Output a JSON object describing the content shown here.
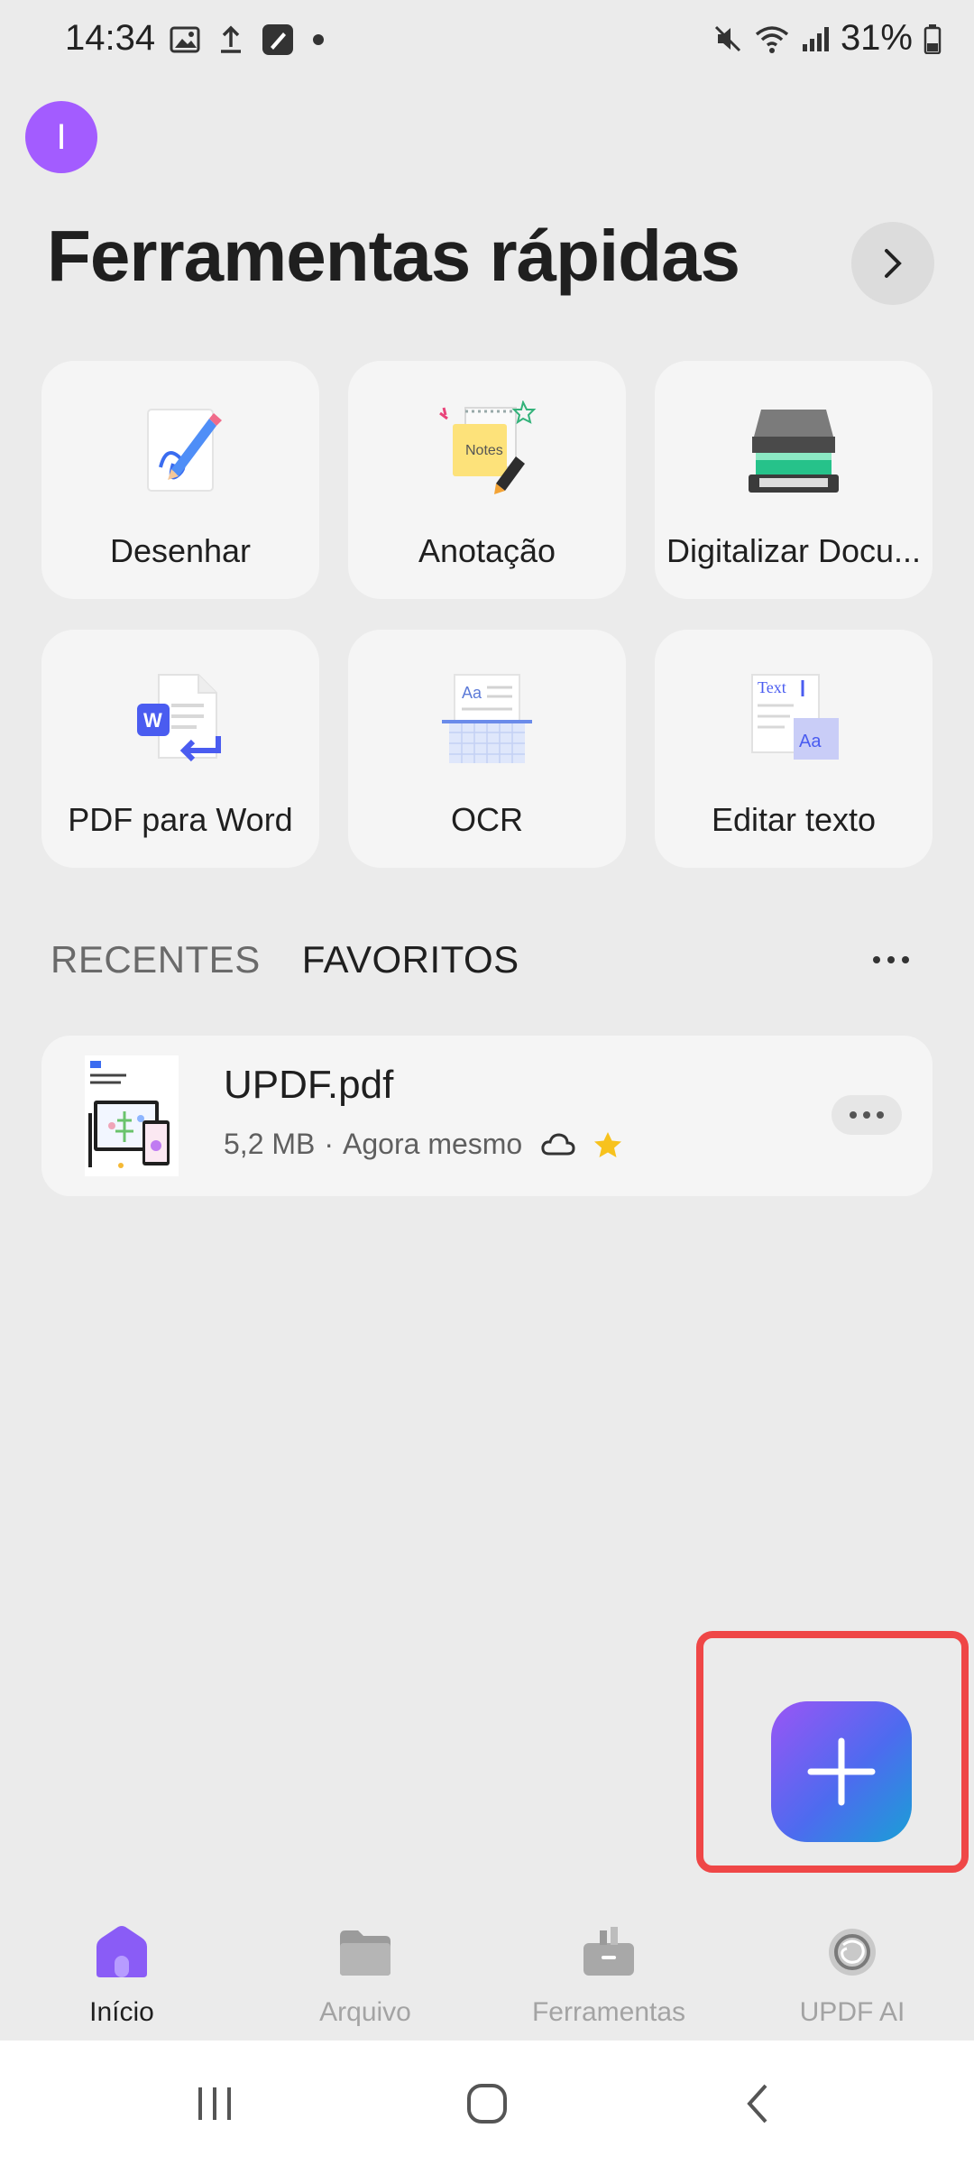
{
  "status_bar": {
    "time": "14:34",
    "battery": "31%"
  },
  "avatar": {
    "initial": "I"
  },
  "quick_tools": {
    "title": "Ferramentas rápidas",
    "items": [
      {
        "label": "Desenhar",
        "icon": "draw-icon"
      },
      {
        "label": "Anotação",
        "icon": "notes-icon"
      },
      {
        "label": "Digitalizar Docu...",
        "icon": "scanner-icon"
      },
      {
        "label": "PDF para Word",
        "icon": "pdf-to-word-icon"
      },
      {
        "label": "OCR",
        "icon": "ocr-icon"
      },
      {
        "label": "Editar texto",
        "icon": "edit-text-icon"
      }
    ]
  },
  "tabs": {
    "recent": "RECENTES",
    "favorites": "FAVORITOS",
    "active": "FAVORITOS"
  },
  "files": [
    {
      "name": "UPDF.pdf",
      "size": "5,2 MB",
      "time": "Agora mesmo",
      "cloud": true,
      "favorite": true
    }
  ],
  "bottom_nav": {
    "items": [
      {
        "label": "Início",
        "icon": "home-icon",
        "active": true
      },
      {
        "label": "Arquivo",
        "icon": "folder-icon",
        "active": false
      },
      {
        "label": "Ferramentas",
        "icon": "toolbox-icon",
        "active": false
      },
      {
        "label": "UPDF AI",
        "icon": "ai-icon",
        "active": false
      }
    ]
  },
  "colors": {
    "accent": "#8a5cf6",
    "highlight": "#ef4747",
    "background": "#ebebeb"
  }
}
